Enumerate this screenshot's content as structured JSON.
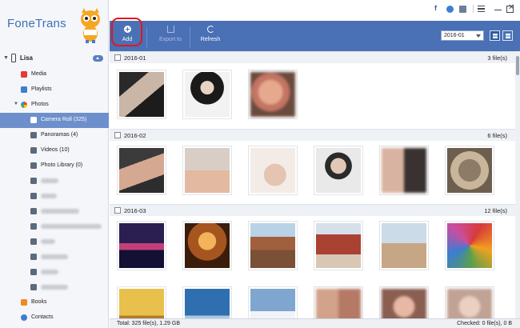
{
  "app": {
    "name": "FoneTrans"
  },
  "device": {
    "name": "Lisa"
  },
  "sidebar": {
    "items": [
      {
        "label": "Media"
      },
      {
        "label": "Playlists"
      },
      {
        "label": "Photos"
      },
      {
        "label": "Camera Roll (325)"
      },
      {
        "label": "Panoramas (4)"
      },
      {
        "label": "Videos (10)"
      },
      {
        "label": "Photo Library (0)"
      },
      {
        "label": "Books"
      },
      {
        "label": "Contacts"
      }
    ]
  },
  "toolbar": {
    "add_label": "Add",
    "export_label": "Export to",
    "refresh_label": "Refresh",
    "date_value": "2016-01"
  },
  "groups": [
    {
      "date": "2016-01",
      "count": "3 file(s)"
    },
    {
      "date": "2016-02",
      "count": "6 file(s)"
    },
    {
      "date": "2016-03",
      "count": "12 file(s)"
    }
  ],
  "status": {
    "total": "Total: 325 file(s), 1.29 GB",
    "checked": "Checked: 0 file(s), 0 B"
  },
  "colors": {
    "brand_blue": "#4a70b5",
    "selection": "#6d8fcb",
    "highlight_ring": "#e3161b"
  },
  "icons": {
    "top": [
      "facebook-icon",
      "chat-icon",
      "feedback-icon",
      "menu-icon",
      "minimize-icon",
      "maximize-icon",
      "close-icon"
    ],
    "toolbar": [
      "add-icon",
      "export-icon",
      "refresh-icon",
      "grid-view-icon",
      "list-view-icon"
    ]
  }
}
